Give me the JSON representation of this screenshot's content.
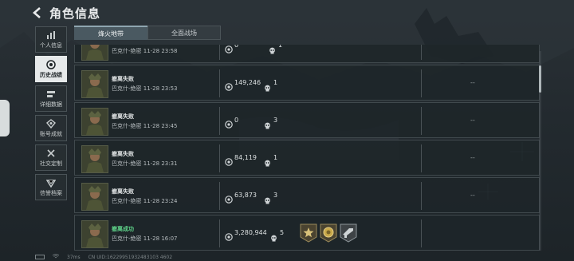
{
  "header": {
    "title": "角色信息"
  },
  "sidebar": {
    "items": [
      {
        "label": "个人信息",
        "icon": "bar-chart-icon"
      },
      {
        "label": "历史战绩",
        "icon": "record-icon"
      },
      {
        "label": "详细数据",
        "icon": "data-icon"
      },
      {
        "label": "账号成就",
        "icon": "achievement-icon"
      },
      {
        "label": "社交定制",
        "icon": "social-icon"
      },
      {
        "label": "信誉档案",
        "icon": "credit-icon"
      }
    ]
  },
  "tabs": [
    {
      "label": "烽火地带"
    },
    {
      "label": "全面战场"
    }
  ],
  "records": [
    {
      "status": "",
      "sub": "巴克什-绝密 11-28 23:58",
      "value": "0",
      "kills": "1",
      "dash": ""
    },
    {
      "status": "撤离失败",
      "sub": "巴克什-绝密 11-28 23:53",
      "value": "149,246",
      "kills": "1",
      "dash": "--"
    },
    {
      "status": "撤离失败",
      "sub": "巴克什-绝密 11-28 23:45",
      "value": "0",
      "kills": "3",
      "dash": "--"
    },
    {
      "status": "撤离失败",
      "sub": "巴克什-绝密 11-28 23:31",
      "value": "84,119",
      "kills": "1",
      "dash": "--"
    },
    {
      "status": "撤离失败",
      "sub": "巴克什-绝密 11-28 23:24",
      "value": "63,873",
      "kills": "3",
      "dash": "--"
    },
    {
      "status": "撤离成功",
      "sub": "巴克什-绝密 11-28 16:07",
      "value": "3,280,944",
      "kills": "5",
      "dash": ""
    }
  ],
  "colors": {
    "win": "#5fd48a",
    "active_tab": "#4a5961"
  },
  "footer": {
    "ping": "37ms",
    "uid": "CN UID:16229951932483103 4602"
  }
}
